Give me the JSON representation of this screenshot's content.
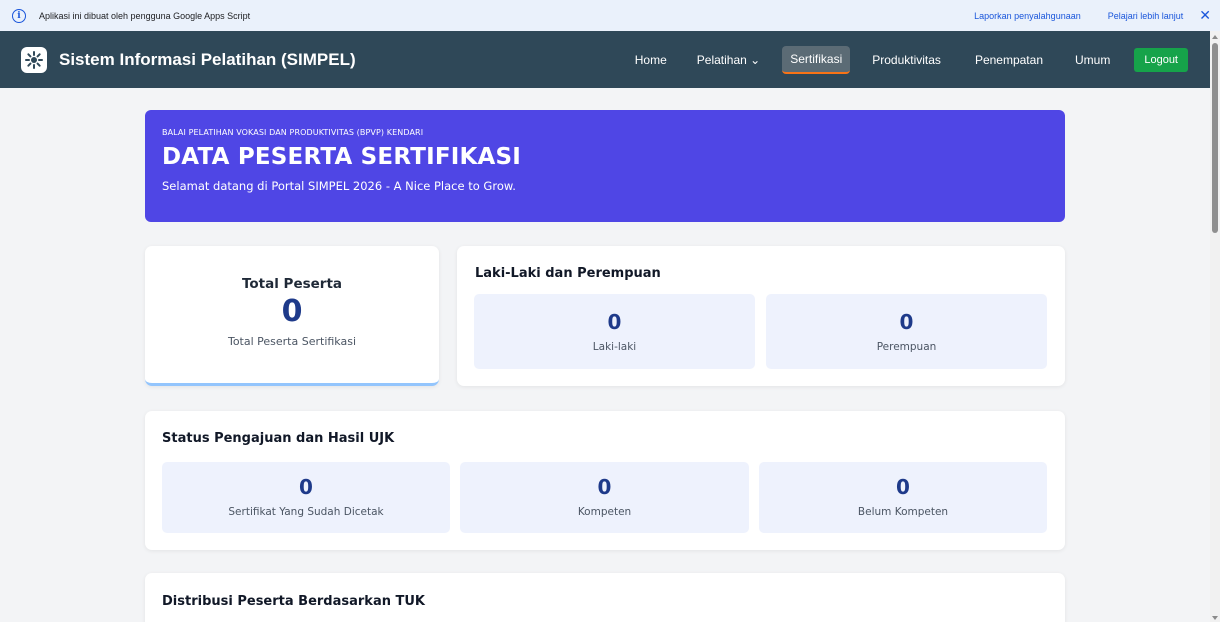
{
  "gas_banner": {
    "text": "Aplikasi ini dibuat oleh pengguna Google Apps Script",
    "report_link": "Laporkan penyalahgunaan",
    "learn_link": "Pelajari lebih lanjut",
    "close": "✕",
    "info_icon": "info-icon"
  },
  "navbar": {
    "brand": "Sistem Informasi Pelatihan (SIMPEL)",
    "items": [
      {
        "label": "Home"
      },
      {
        "label": "Pelatihan ⌄"
      },
      {
        "label": "Sertifikasi"
      },
      {
        "label": "Produktivitas"
      },
      {
        "label": "Penempatan"
      },
      {
        "label": "Umum"
      }
    ],
    "active": "Sertifikasi",
    "logout": "Logout"
  },
  "hero": {
    "eyebrow": "BALAI PELATIHAN VOKASI DAN PRODUKTIVITAS (BPVP) KENDARI",
    "title": "DATA PESERTA SERTIFIKASI",
    "subtitle": "Selamat datang di Portal SIMPEL 2026 - A Nice Place to Grow."
  },
  "total": {
    "label": "Total Peserta",
    "value": "0",
    "sub": "Total Peserta Sertifikasi"
  },
  "gender": {
    "title": "Laki-Laki dan Perempuan",
    "male": {
      "value": "0",
      "label": "Laki-laki"
    },
    "female": {
      "value": "0",
      "label": "Perempuan"
    }
  },
  "status": {
    "title": "Status Pengajuan dan Hasil UJK",
    "printed": {
      "value": "0",
      "label": "Sertifikat Yang Sudah Dicetak"
    },
    "competent": {
      "value": "0",
      "label": "Kompeten"
    },
    "not_competent": {
      "value": "0",
      "label": "Belum Kompeten"
    }
  },
  "distribution": {
    "title": "Distribusi Peserta Berdasarkan TUK"
  },
  "colors": {
    "navbar": "#2f4858",
    "hero": "#4f46e5",
    "stat_bg": "#eef2fd",
    "stat_value": "#1e3a8a",
    "logout": "#16a34a",
    "active_underline": "#f97316"
  }
}
